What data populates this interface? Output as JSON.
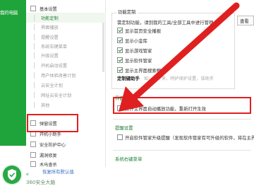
{
  "app": {
    "title": "我的电脑",
    "brand_prefix": "e",
    "brand": "360安全大脑"
  },
  "sidebar": {
    "items": [
      {
        "label": "基本设置",
        "kind": "top"
      },
      {
        "label": "功能定制",
        "kind": "child",
        "selected": true
      },
      {
        "label": "界面播放",
        "kind": "child"
      },
      {
        "label": "提醒设置",
        "kind": "child"
      },
      {
        "label": "系统右键菜单",
        "kind": "child"
      },
      {
        "label": "升级设置",
        "kind": "child"
      },
      {
        "label": "开机启动设置",
        "kind": "child"
      },
      {
        "label": "用户体验改善计划",
        "kind": "child"
      },
      {
        "label": "云安全计划",
        "kind": "child"
      },
      {
        "label": "网址云安全计划",
        "kind": "child"
      },
      {
        "label": "其他",
        "kind": "child"
      },
      {
        "label": "弹窗设置",
        "kind": "top"
      },
      {
        "label": "开机小助手",
        "kind": "top"
      },
      {
        "label": "安全防护中心",
        "kind": "top"
      },
      {
        "label": "漏洞修复",
        "kind": "top"
      },
      {
        "label": "木马查杀",
        "kind": "top"
      }
    ],
    "restore_link": "恢复所有默认值"
  },
  "main": {
    "group_title": "功能定制",
    "description": "需定制功能，请到我的工具/全部工具中进行管理",
    "search_button": "查看",
    "options": [
      {
        "label": "显示首页安全播报",
        "checked": true
      },
      {
        "label": "显示小金库",
        "checked": true
      },
      {
        "label": "显示游戏管家",
        "checked": true
      },
      {
        "label": "显示软件管家",
        "checked": true
      },
      {
        "label": "显示主界面搜索框",
        "checked": true
      }
    ],
    "hotkey_label": "定制键助手",
    "hotkey_hint": "如：文件夹、同护保护设置，该助手",
    "section_interface": "界面",
    "interface_option": "打开主界面自动播放功能，重新打开生效",
    "section_remind": "提醒设置",
    "remind_option": "开启软件管家升级提醒（发现软件管家有可升级的软件，将在主界",
    "section_right_menu": "系统右键菜单"
  },
  "colors": {
    "accent_green": "#1fa33b",
    "annotation_red": "#e02020"
  }
}
